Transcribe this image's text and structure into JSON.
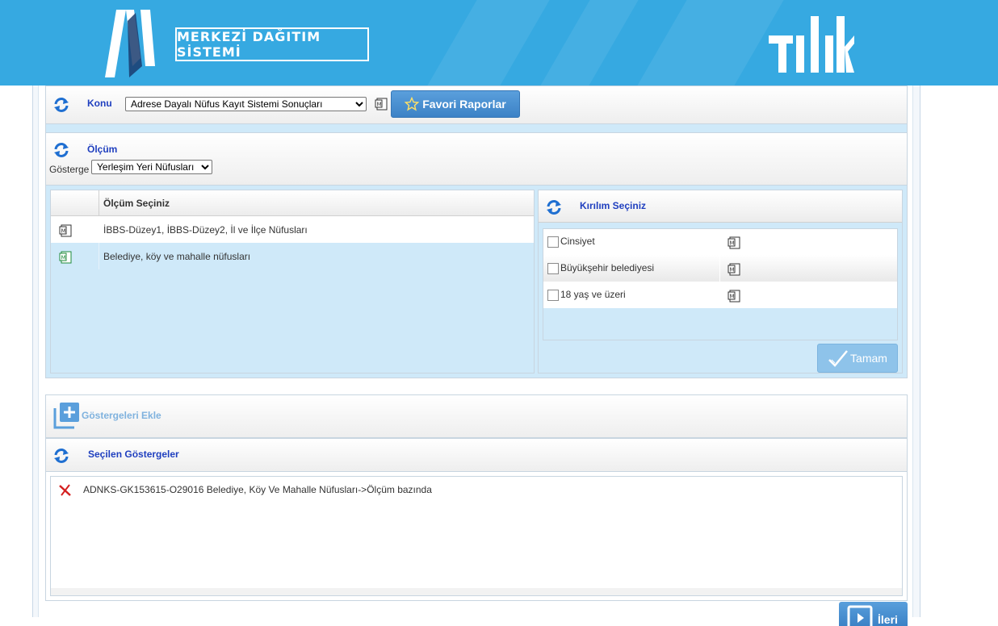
{
  "header": {
    "system_title": "MERKEZİ DAĞITIM SİSTEMİ",
    "brand_color": "#36a9e1"
  },
  "konu": {
    "label": "Konu",
    "selected": "Adrese Dayalı Nüfus Kayıt Sistemi Sonuçları",
    "favorites_button": "Favori Raporlar"
  },
  "olcum": {
    "title": "Ölçüm",
    "gosterge_label": "Gösterge",
    "gosterge_selected": "Yerleşim Yeri Nüfusları",
    "column_header": "Ölçüm Seçiniz",
    "rows": [
      {
        "label": "İBBS-Düzey1, İBBS-Düzey2, İl ve İlçe Nüfusları",
        "selected": false
      },
      {
        "label": "Belediye, köy ve mahalle nüfusları",
        "selected": true
      }
    ]
  },
  "kirilim": {
    "title": "Kırılım Seçiniz",
    "items": [
      {
        "label": "Cinsiyet",
        "checked": false
      },
      {
        "label": "Büyükşehir belediyesi",
        "checked": false
      },
      {
        "label": "18 yaş ve üzeri",
        "checked": false
      }
    ],
    "ok_button": "Tamam"
  },
  "gostergeler": {
    "add_label": "Göstergeleri Ekle",
    "selected_title": "Seçilen Göstergeler",
    "selected_items": [
      "ADNKS-GK153615-O29016 Belediye, Köy Ve Mahalle Nüfusları->Ölçüm bazında"
    ]
  },
  "footer": {
    "next_button": "İleri"
  }
}
